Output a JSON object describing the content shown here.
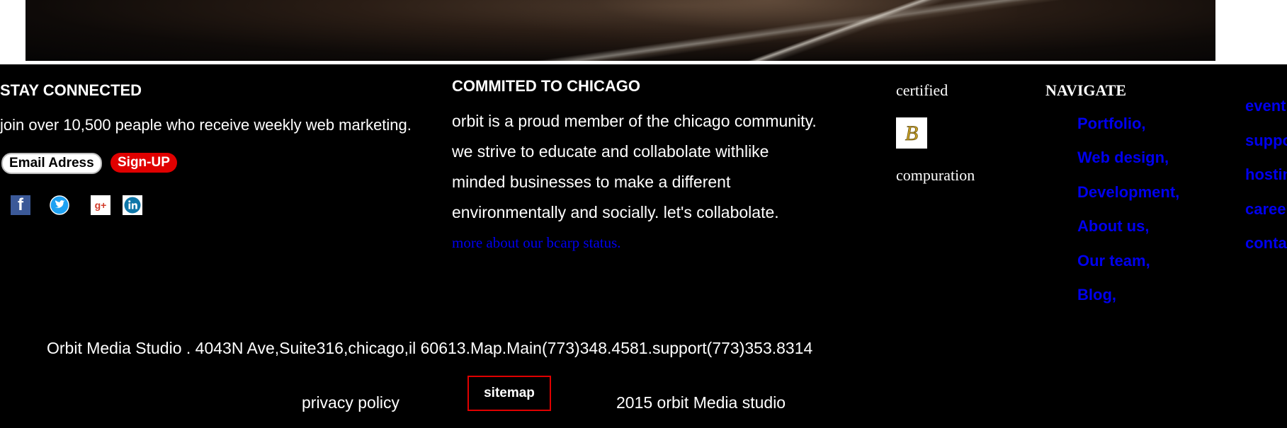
{
  "stay_connected": {
    "title": "STAY CONNECTED",
    "text": "join over 10,500 peaple who receive weekly web marketing.",
    "email_label": "Email Adress",
    "signup_label": "Sign-UP",
    "social_icons": [
      "facebook-icon",
      "twitter-icon",
      "google-plus-icon",
      "linkedin-icon"
    ]
  },
  "chicago": {
    "title": "COMMITED TO CHICAGO",
    "lines": [
      "orbit is a proud member of the chicago community.",
      "we strive to educate and collabolate withlike",
      "minded businesses to make a different",
      "environmentally and socially. let's collabolate."
    ],
    "link": "more about our bcarp status."
  },
  "certified": {
    "label": "certified",
    "badge_letter": "B",
    "sub": "compuration"
  },
  "navigate": {
    "title": "NAVIGATE",
    "items": [
      "Portfolio,",
      "Web design,",
      "Development,",
      "About us,",
      "Our team,",
      "Blog,"
    ]
  },
  "more_links": {
    "items": [
      "event",
      "suppo",
      "hostin",
      "caree",
      "conta"
    ]
  },
  "bottom": {
    "address": "Orbit Media Studio . 4043N Ave,Suite316,chicago,il 60613.Map.Main(773)348.4581.support(773)353.8314",
    "privacy": "privacy policy",
    "sitemap": "sitemap",
    "copyright": "2015 orbit Media studio"
  },
  "colors": {
    "background": "#000000",
    "text": "#ffffff",
    "link": "#0000ee",
    "signup": "#e00000",
    "sitemap_border": "#e00000"
  }
}
